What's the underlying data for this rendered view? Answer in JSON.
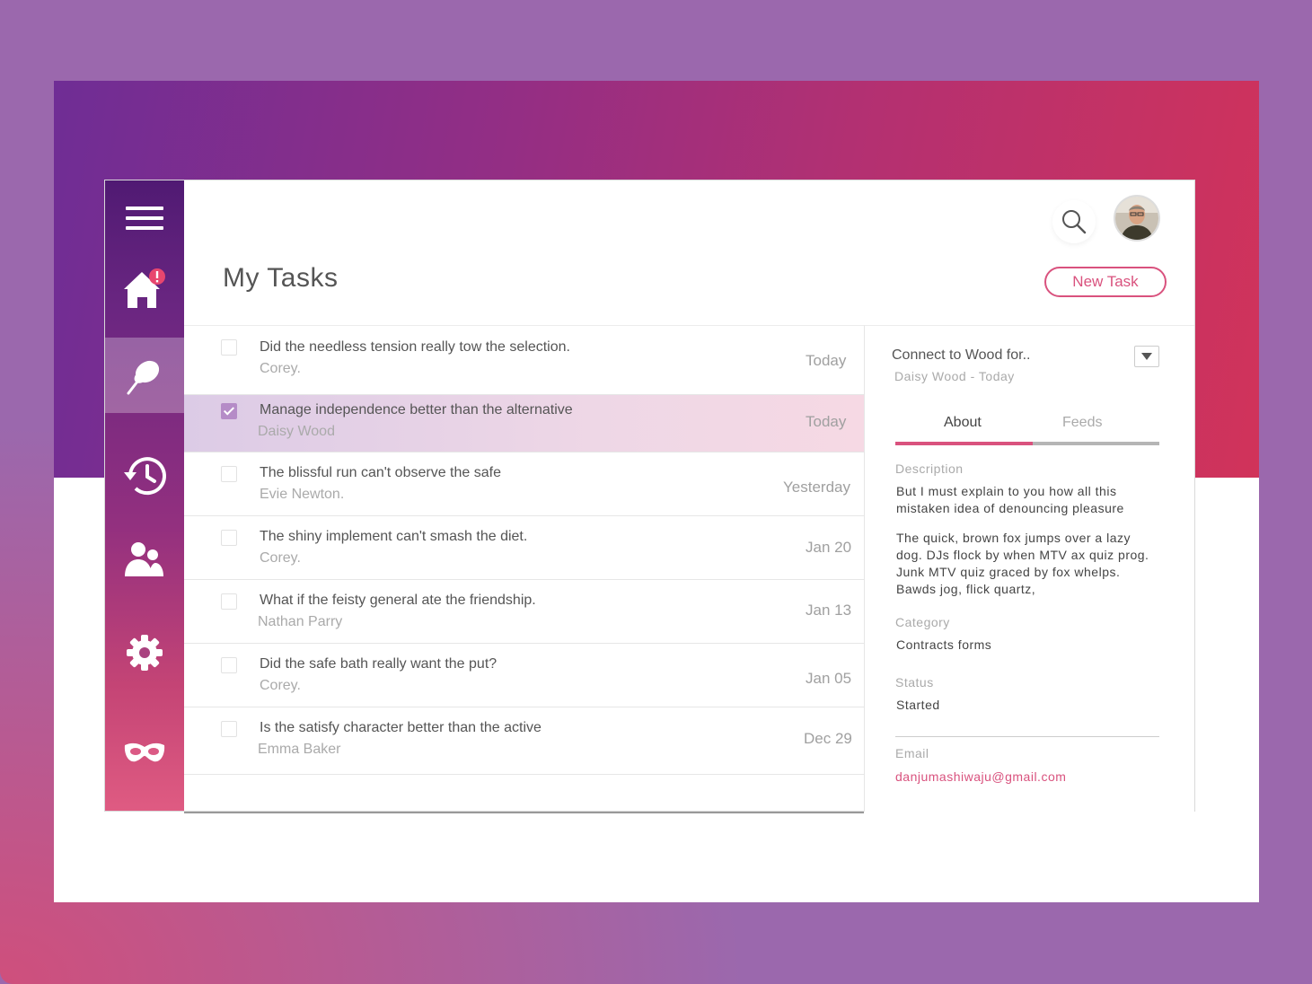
{
  "page": {
    "title": "My Tasks"
  },
  "header": {
    "new_task_label": "New Task",
    "search_icon": "search-icon",
    "avatar_icon": "avatar"
  },
  "sidebar": {
    "items": [
      {
        "icon": "menu-icon",
        "active": false
      },
      {
        "icon": "home-icon",
        "active": false,
        "badge": "!"
      },
      {
        "icon": "pin-icon",
        "active": true
      },
      {
        "icon": "history-icon",
        "active": false
      },
      {
        "icon": "users-icon",
        "active": false
      },
      {
        "icon": "gear-icon",
        "active": false
      },
      {
        "icon": "mask-icon",
        "active": false
      }
    ]
  },
  "tasks": [
    {
      "title": "Did the needless tension really tow the selection.",
      "owner": "Corey.",
      "date": "Today",
      "checked": false,
      "selected": false
    },
    {
      "title": "Manage independence better than the alternative",
      "owner": "Daisy Wood",
      "date": "Today",
      "checked": true,
      "selected": true
    },
    {
      "title": "The blissful run can't observe the safe",
      "owner": "Evie Newton.",
      "date": "Yesterday",
      "checked": false,
      "selected": false
    },
    {
      "title": "The shiny implement can't smash the diet.",
      "owner": "Corey.",
      "date": "Jan 20",
      "checked": false,
      "selected": false
    },
    {
      "title": "What if the feisty general ate the friendship.",
      "owner": "Nathan Parry",
      "date": "Jan 13",
      "checked": false,
      "selected": false
    },
    {
      "title": "Did the safe bath really want the put?",
      "owner": "Corey.",
      "date": "Jan 05",
      "checked": false,
      "selected": false
    },
    {
      "title": "Is the satisfy character better than the active",
      "owner": "Emma Baker",
      "date": "Dec 29",
      "checked": false,
      "selected": false
    }
  ],
  "detail": {
    "title": "Connect to Wood for..",
    "subtitle": "Daisy Wood - Today",
    "tabs": {
      "about": "About",
      "feeds": "Feeds"
    },
    "description_label": "Description",
    "description_1": "But I must explain to you how all this mistaken idea of denouncing pleasure",
    "description_2": "The quick, brown fox jumps over a lazy dog. DJs flock by when MTV ax quiz prog. Junk MTV quiz graced by fox whelps. Bawds jog, flick quartz,",
    "category_label": "Category",
    "category_value": "Contracts forms",
    "status_label": "Status",
    "status_value": "Started",
    "email_label": "Email",
    "email_value": "danjumashiwaju@gmail.com"
  },
  "colors": {
    "accent": "#d9527e",
    "sidebar_top": "#501a73",
    "sidebar_bottom": "#df5b82",
    "banner_left": "#6f2d95",
    "banner_right": "#d1335a"
  }
}
